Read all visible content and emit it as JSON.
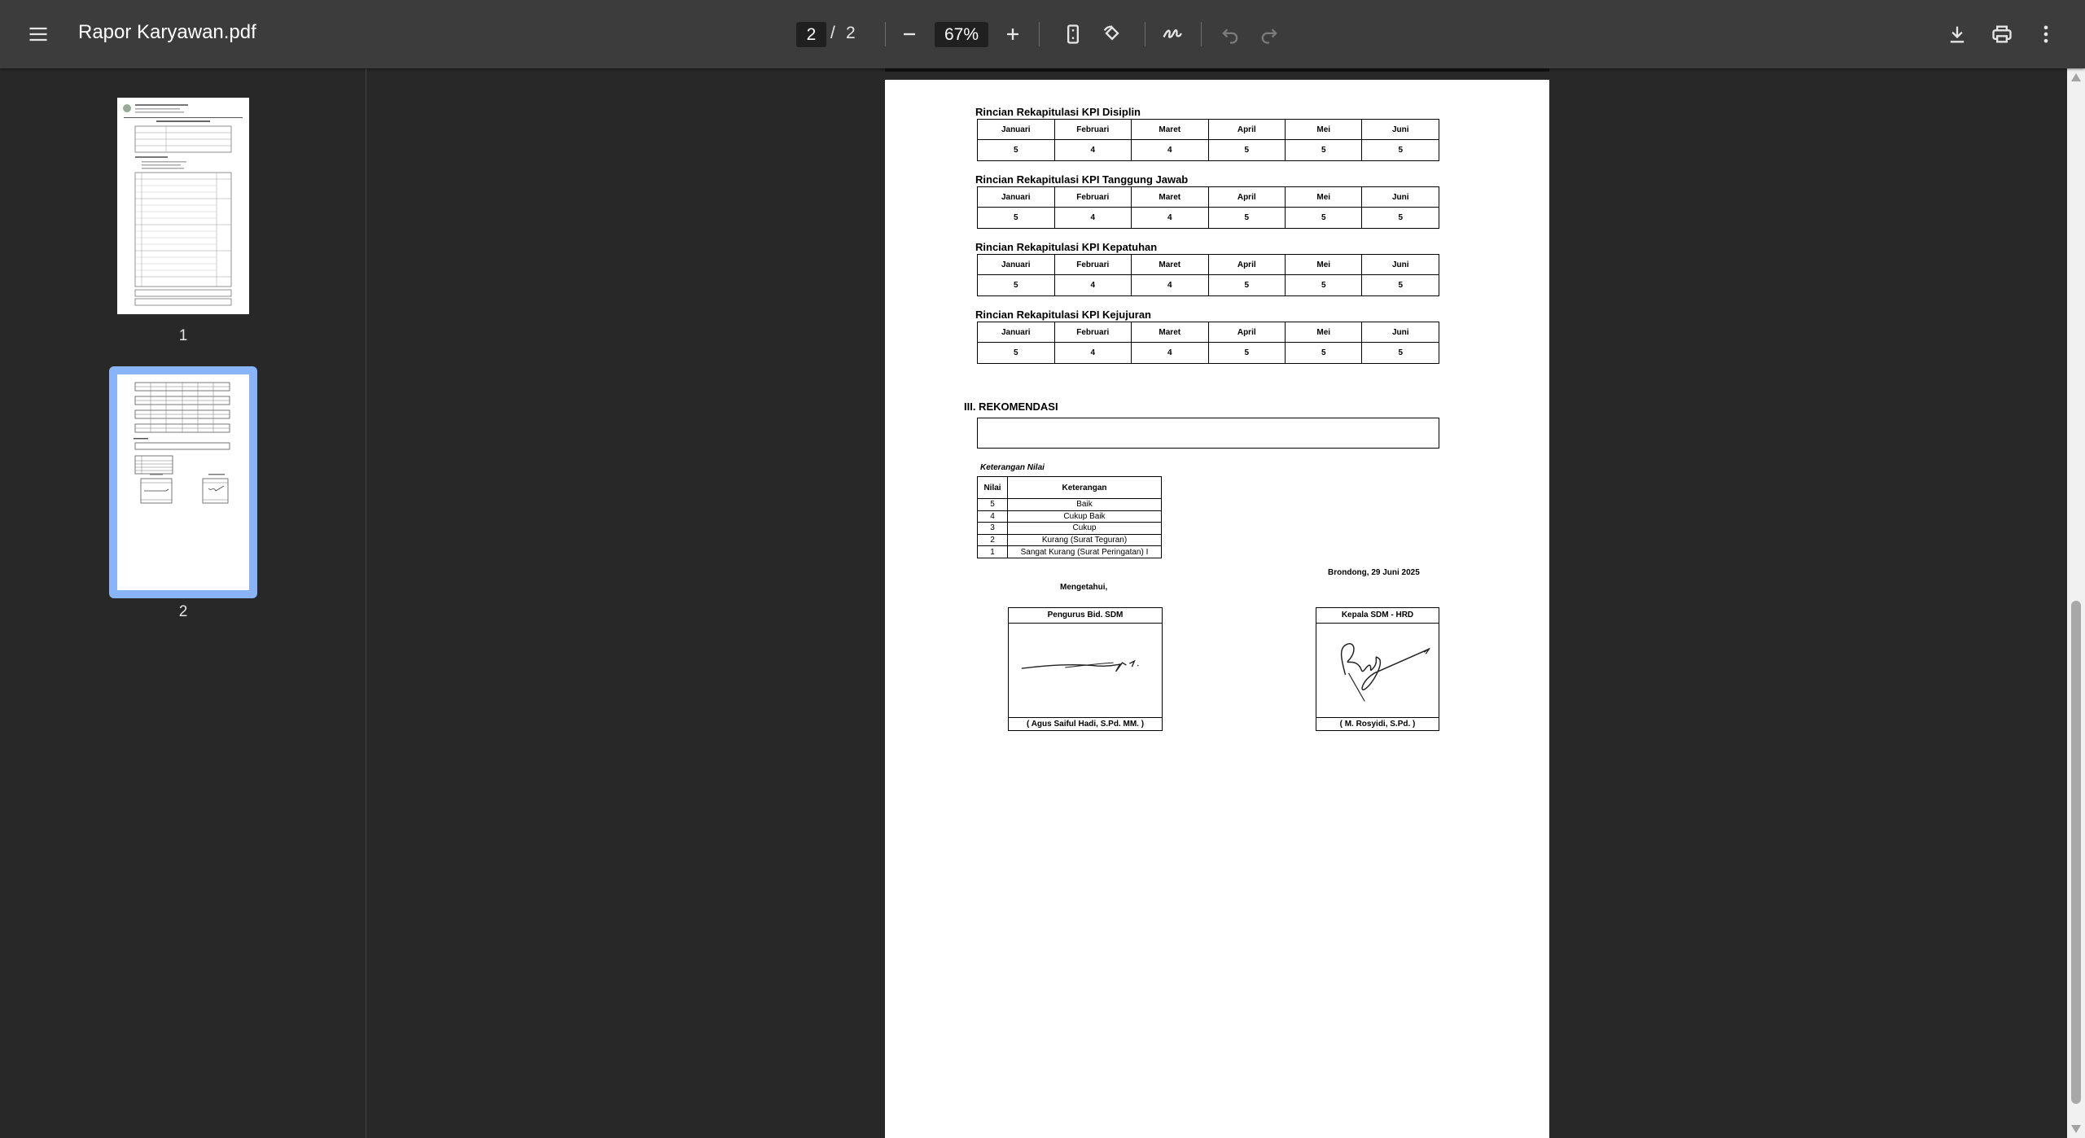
{
  "toolbar": {
    "menu_icon": "hamburger-menu-icon",
    "title": "Rapor Karyawan.pdf",
    "page_current": "2",
    "page_separator": "/",
    "page_total": "2",
    "zoom": "67%",
    "icons": [
      "zoom-out-icon",
      "zoom-in-icon",
      "fit-page-icon",
      "rotate-icon",
      "annotate-icon",
      "undo-icon",
      "redo-icon",
      "download-icon",
      "print-icon",
      "more-options-icon"
    ]
  },
  "sidebar": {
    "thumbnails": [
      {
        "label": "1",
        "selected": false
      },
      {
        "label": "2",
        "selected": true
      }
    ]
  },
  "document": {
    "months": [
      "Januari",
      "Februari",
      "Maret",
      "April",
      "Mei",
      "Juni"
    ],
    "kpi_tables": [
      {
        "title": "Rincian Rekapitulasi KPI Disiplin",
        "values": [
          "5",
          "4",
          "4",
          "5",
          "5",
          "5"
        ]
      },
      {
        "title": "Rincian Rekapitulasi KPI Tanggung Jawab",
        "values": [
          "5",
          "4",
          "4",
          "5",
          "5",
          "5"
        ]
      },
      {
        "title": "Rincian Rekapitulasi KPI Kepatuhan",
        "values": [
          "5",
          "4",
          "4",
          "5",
          "5",
          "5"
        ]
      },
      {
        "title": "Rincian Rekapitulasi KPI Kejujuran",
        "values": [
          "5",
          "4",
          "4",
          "5",
          "5",
          "5"
        ]
      }
    ],
    "section_title": "III. REKOMENDASI",
    "recommendation": "",
    "keterangan_title": "Keterangan Nilai",
    "keterangan_headers": [
      "Nilai",
      "Keterangan"
    ],
    "keterangan_rows": [
      [
        "5",
        "Baik"
      ],
      [
        "4",
        "Cukup Baik"
      ],
      [
        "3",
        "Cukup"
      ],
      [
        "2",
        "Kurang (Surat Teguran)"
      ],
      [
        "1",
        "Sangat Kurang (Surat Peringatan) I"
      ]
    ],
    "date_line": "Brondong, 29 Juni 2025",
    "mengetahui": "Mengetahui,",
    "signatures": [
      {
        "role": "Pengurus Bid. SDM",
        "name": "( Agus Saiful Hadi, S.Pd. MM. )"
      },
      {
        "role": "Kepala SDM - HRD",
        "name": "( M. Rosyidi, S.Pd. )"
      }
    ]
  },
  "colors": {
    "toolbar_bg": "#3c3c3c",
    "viewer_bg": "#282828",
    "selected_thumb": "#8ab4f8"
  }
}
